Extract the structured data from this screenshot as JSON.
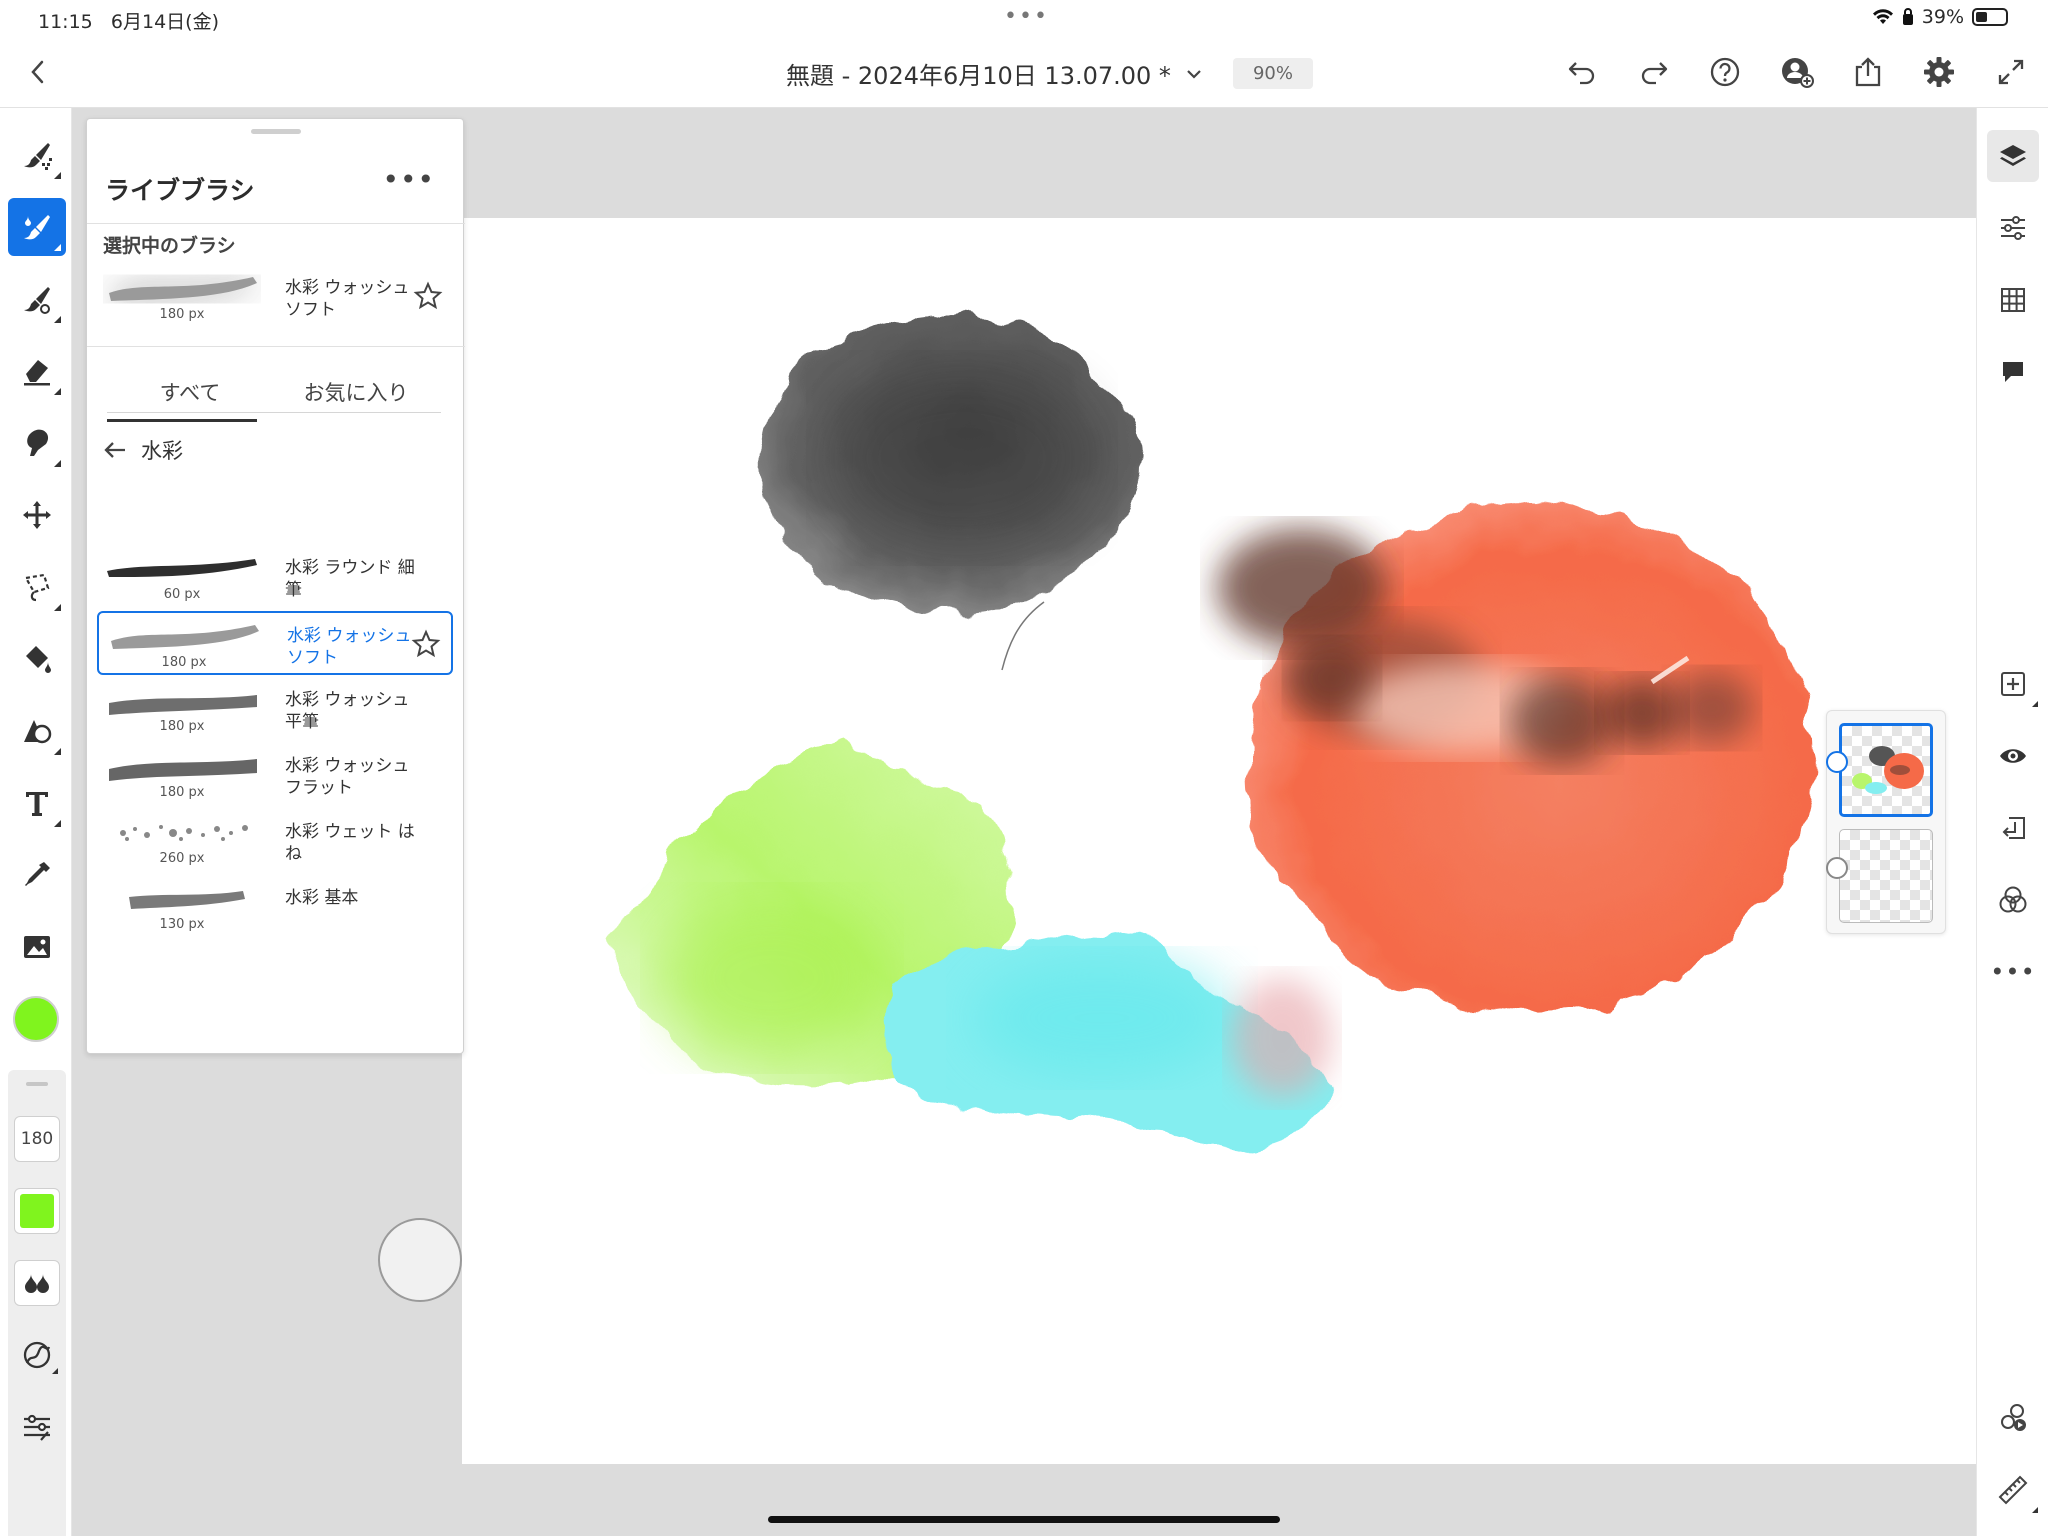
{
  "status": {
    "time": "11:15",
    "date": "6月14日(金)",
    "battery": "39%",
    "battery_level": 0.39
  },
  "document": {
    "title": "無題 - 2024年6月10日 13.07.00 *",
    "zoom": "90%"
  },
  "colors": {
    "accent": "#1473e6",
    "current_color": "#80f41e"
  },
  "left_toolbar": {
    "tools": [
      "pixel-brush-icon",
      "live-brush-icon",
      "vector-brush-icon",
      "eraser-icon",
      "smudge-icon",
      "move-transform-icon",
      "lasso-select-icon",
      "fill-bucket-icon",
      "shape-icon",
      "text-icon",
      "eyedropper-icon",
      "image-place-icon"
    ],
    "active_tool": "live-brush-icon",
    "brush_size": "180"
  },
  "brush_panel": {
    "title": "ライブブラシ",
    "selected_label": "選択中のブラシ",
    "selected_brush": {
      "name": "水彩 ウォッシュ ソフト",
      "size": "180 px"
    },
    "tabs": [
      {
        "label": "すべて",
        "active": true
      },
      {
        "label": "お気に入り",
        "active": false
      }
    ],
    "category": "水彩",
    "brushes": [
      {
        "name": "水彩 ラウンド 細筆",
        "size": "60 px",
        "active": false
      },
      {
        "name": "水彩 ウォッシュ ソフト",
        "size": "180 px",
        "active": true
      },
      {
        "name": "水彩 ウォッシュ 平筆",
        "size": "180 px",
        "active": false
      },
      {
        "name": "水彩 ウォッシュ フラット",
        "size": "180 px",
        "active": false
      },
      {
        "name": "水彩 ウェット はね",
        "size": "260 px",
        "active": false
      },
      {
        "name": "水彩 基本",
        "size": "130 px",
        "active": false
      }
    ]
  },
  "right_toolbar": {
    "tools": [
      "layers-icon",
      "layer-properties-icon",
      "grid-icon",
      "comment-icon",
      "add-layer-icon",
      "visibility-icon",
      "merge-down-icon",
      "blend-icon",
      "more-icon",
      "timelapse-icon",
      "ruler-icon"
    ]
  },
  "layers": {
    "count": 2,
    "selected_index": 0
  }
}
